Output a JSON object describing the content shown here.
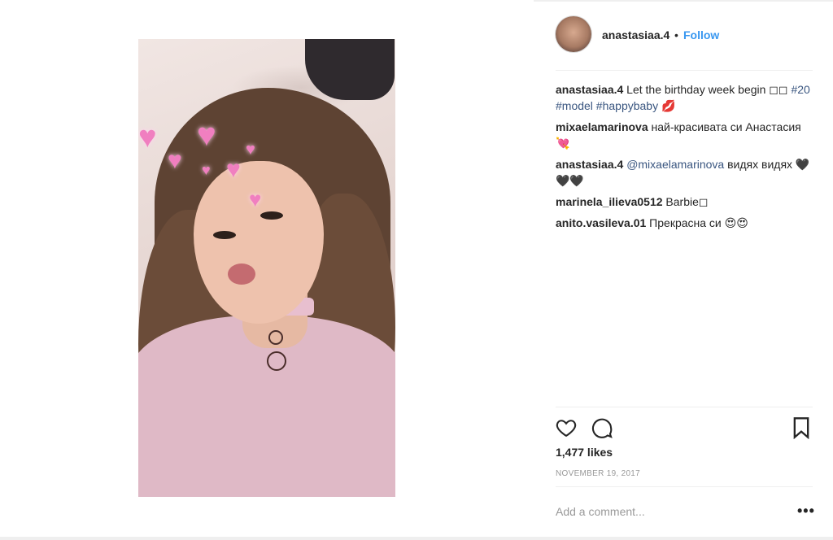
{
  "post": {
    "username": "anastasiaa.4",
    "separator": "•",
    "follow_label": "Follow",
    "likes": "1,477 likes",
    "date": "NOVEMBER 19, 2017",
    "comment_placeholder": "Add a comment...",
    "more_label": "•••"
  },
  "comments": [
    {
      "user": "anastasiaa.4",
      "text": " Let the birthday week begin ◻◻ ",
      "tags": "#20 #model #happybaby",
      "suffix": " 💋"
    },
    {
      "user": "mixaelamarinova",
      "text": " най-красивата си Анастасия 💘"
    },
    {
      "user": "anastasiaa.4",
      "mention": "@mixaelamarinova",
      "text": " видях видях 🖤🖤🖤"
    },
    {
      "user": "marinela_ilieva0512",
      "text": " Barbie◻"
    },
    {
      "user": "anito.vasileva.01",
      "text": " Прекрасна си 😍😍"
    }
  ],
  "icons": {
    "like": "heart-outline-icon",
    "comment": "speech-bubble-icon",
    "save": "bookmark-icon",
    "more": "ellipsis-icon"
  },
  "colors": {
    "link": "#3897f0",
    "text": "#262626",
    "muted": "#999999",
    "divider": "#efefef"
  }
}
